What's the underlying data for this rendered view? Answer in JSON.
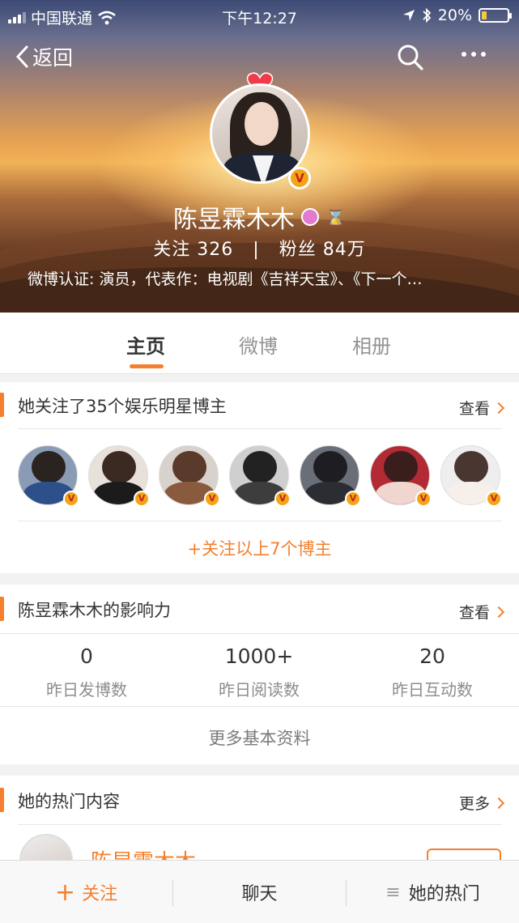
{
  "status_bar": {
    "carrier": "中国联通",
    "time": "下午12:27",
    "battery": "20%",
    "battery_level": 0.2,
    "icons": [
      "signal-icon",
      "wifi-icon",
      "location-icon",
      "bluetooth-icon",
      "battery-icon"
    ]
  },
  "nav": {
    "back_label": "返回",
    "icons": [
      "back-chevron-icon",
      "search-icon",
      "more-icon"
    ]
  },
  "profile": {
    "name": "陈昱霖木木",
    "following_label": "关注",
    "following_count": "326",
    "separator": "|",
    "followers_label": "粉丝",
    "followers_count": "84万",
    "verification": "微博认证: 演员，代表作：电视剧《吉祥天宝》、《下一个…",
    "verified_badge": "V",
    "colors": {
      "accent": "#f47f2d",
      "badge_gold": "#f3a417",
      "member_pink": "#e07bd0"
    }
  },
  "tabs": [
    {
      "label": "主页",
      "active": true
    },
    {
      "label": "微博",
      "active": false
    },
    {
      "label": "相册",
      "active": false
    }
  ],
  "follows_card": {
    "title": "她关注了35个娱乐明星博主",
    "more": "查看",
    "stars_count": 7,
    "follow_all": "+关注以上7个博主"
  },
  "influence_card": {
    "title": "陈昱霖木木的影响力",
    "more": "查看",
    "stats": [
      {
        "value": "0",
        "label": "昨日发博数"
      },
      {
        "value": "1000+",
        "label": "昨日阅读数"
      },
      {
        "value": "20",
        "label": "昨日互动数"
      }
    ],
    "more_info": "更多基本资料"
  },
  "hot_card": {
    "title": "她的热门内容",
    "more": "更多",
    "item_name": "陈昱霖木木"
  },
  "bottom_bar": {
    "follow": "关注",
    "follow_icon": "+",
    "chat": "聊天",
    "hot": "她的热门",
    "hot_icon": "≡"
  }
}
